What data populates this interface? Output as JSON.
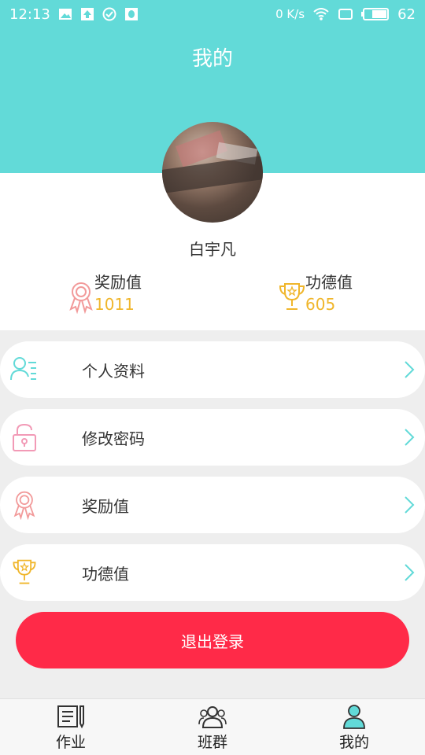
{
  "status_bar": {
    "time": "12:13",
    "speed": "0 K/s",
    "battery": "62"
  },
  "header": {
    "title": "我的"
  },
  "profile": {
    "username": "白宇凡",
    "award_label": "奖励值",
    "award_value": "1011",
    "merit_label": "功德值",
    "merit_value": "605"
  },
  "menu": [
    {
      "label": "个人资料",
      "icon": "person-list-icon"
    },
    {
      "label": "修改密码",
      "icon": "lock-icon"
    },
    {
      "label": "奖励值",
      "icon": "medal-icon"
    },
    {
      "label": "功德值",
      "icon": "trophy-icon"
    }
  ],
  "logout_label": "退出登录",
  "tabs": [
    {
      "label": "作业",
      "icon": "homework-icon"
    },
    {
      "label": "班群",
      "icon": "group-icon"
    },
    {
      "label": "我的",
      "icon": "profile-icon",
      "active": true
    }
  ],
  "colors": {
    "header_bg": "#62dad8",
    "accent_gold": "#f0b62b",
    "logout_red": "#ff2a48"
  }
}
